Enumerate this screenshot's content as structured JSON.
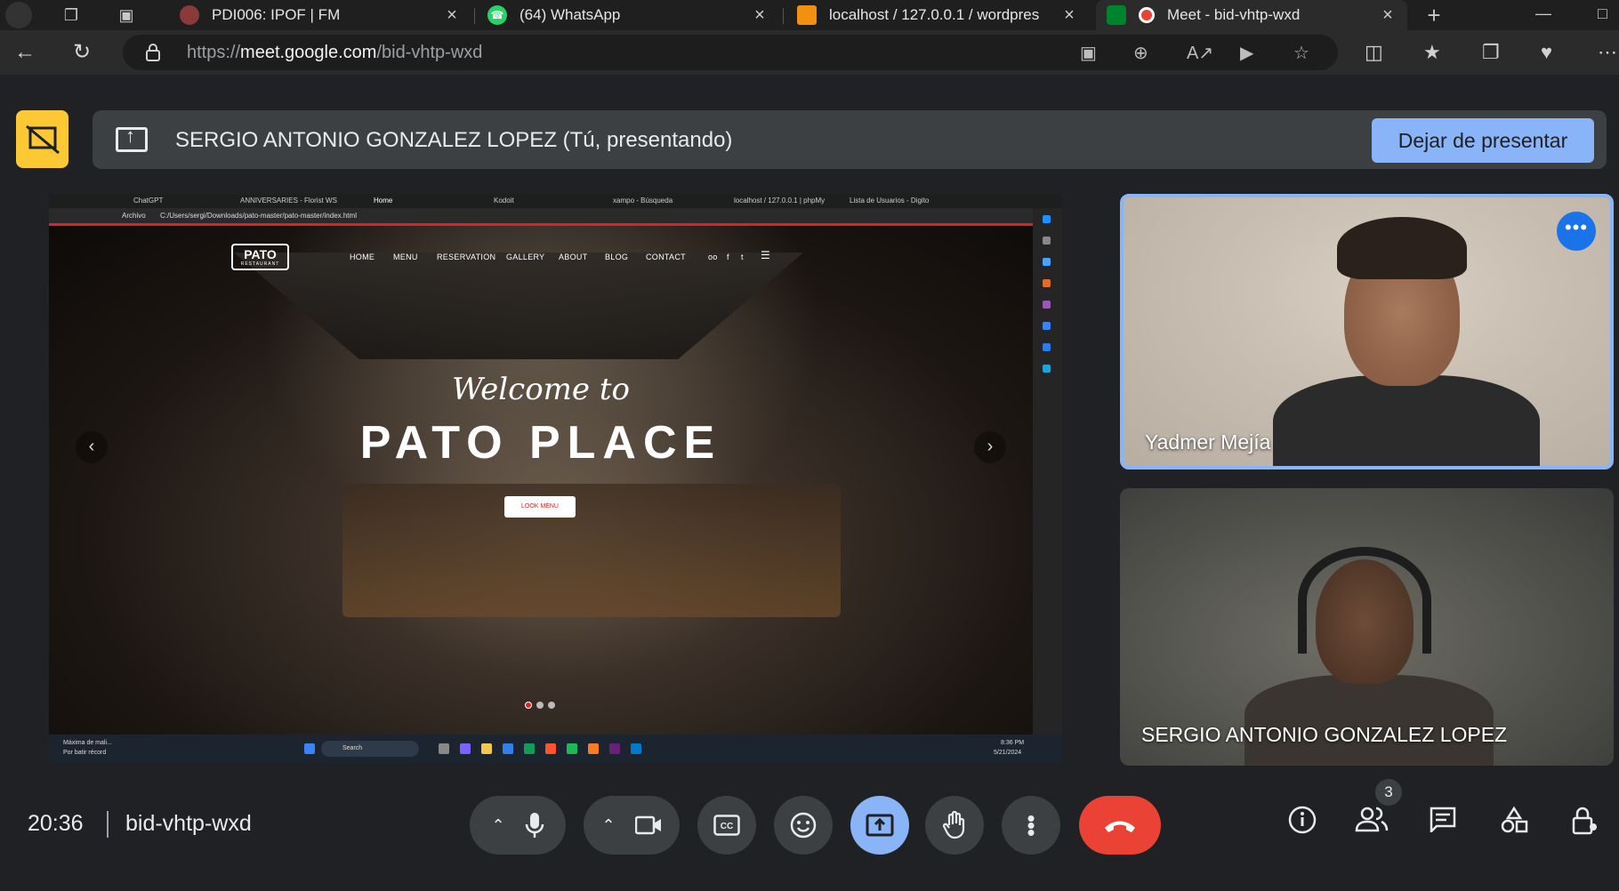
{
  "browser": {
    "tabs": [
      {
        "title": "PDI006: IPOF | FM",
        "fav_color": "#8b3a3a"
      },
      {
        "title": "(64) WhatsApp",
        "fav_color": "#25d366"
      },
      {
        "title": "localhost / 127.0.0.1 / wordpres",
        "fav_color": "#f29111"
      },
      {
        "title": "Meet - bid-vhtp-wxd",
        "fav_color": "#ea4335"
      }
    ],
    "url_prefix": "https://",
    "url_host": "meet.google.com",
    "url_path": "/bid-vhtp-wxd"
  },
  "banner": {
    "text": "SERGIO ANTONIO GONZALEZ LOPEZ (Tú, presentando)",
    "stop_label": "Dejar de presentar"
  },
  "shared": {
    "tabs": [
      "ChatGPT",
      "ANNIVERSARIES - Florist WS",
      "Home",
      "Kodoit",
      "xampo - Búsqueda",
      "localhost / 127.0.0.1 | phpMy",
      "Lista de Usuarios - Digito"
    ],
    "addr_label": "Archivo",
    "addr_path": "C:/Users/sergi/Downloads/pato-master/pato-master/index.html",
    "logo": "PATO",
    "logo_sub": "RESTAURANT",
    "nav": [
      "HOME",
      "MENU",
      "RESERVATION",
      "GALLERY",
      "ABOUT",
      "BLOG",
      "CONTACT"
    ],
    "welcome": "Welcome to",
    "headline": "PATO PLACE",
    "cta": "LOOK MENU",
    "taskbar_notice_1": "Máxima de mali...",
    "taskbar_notice_2": "Por batir récord",
    "search": "Search",
    "time": "8:36 PM",
    "date": "5/21/2024"
  },
  "participants": [
    {
      "name": "Yadmer Mejía"
    },
    {
      "name": "SERGIO ANTONIO GONZALEZ LOPEZ"
    }
  ],
  "meeting": {
    "time": "20:36",
    "code": "bid-vhtp-wxd",
    "people_count": "3"
  },
  "colors": {
    "accent_blue": "#8ab4f8",
    "end_call_red": "#ea4335",
    "present_yellow": "#fcc934"
  }
}
